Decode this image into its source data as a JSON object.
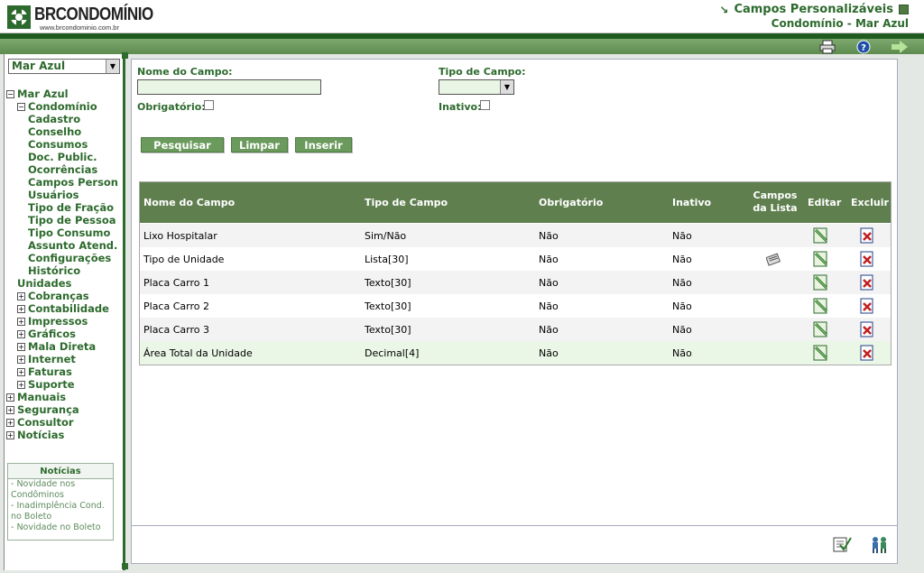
{
  "header": {
    "brand": "BRCONDOMÍNIO",
    "url": "www.brcondominio.com.br",
    "title": "Campos Personalizáveis",
    "subtitle": "Condomínio - Mar Azul"
  },
  "sidebar": {
    "condo_select": "Mar Azul",
    "tree": [
      {
        "label": "Mar Azul",
        "level": 0,
        "toggle": "−"
      },
      {
        "label": "Condomínio",
        "level": 1,
        "toggle": "−"
      },
      {
        "label": "Cadastro",
        "level": 2,
        "toggle": ""
      },
      {
        "label": "Conselho",
        "level": 2,
        "toggle": ""
      },
      {
        "label": "Consumos",
        "level": 2,
        "toggle": ""
      },
      {
        "label": "Doc. Public.",
        "level": 2,
        "toggle": ""
      },
      {
        "label": "Ocorrências",
        "level": 2,
        "toggle": ""
      },
      {
        "label": "Campos Person",
        "level": 2,
        "toggle": ""
      },
      {
        "label": "Usuários",
        "level": 2,
        "toggle": ""
      },
      {
        "label": "Tipo de Fração",
        "level": 2,
        "toggle": ""
      },
      {
        "label": "Tipo de Pessoa",
        "level": 2,
        "toggle": ""
      },
      {
        "label": "Tipo Consumo",
        "level": 2,
        "toggle": ""
      },
      {
        "label": "Assunto Atend.",
        "level": 2,
        "toggle": ""
      },
      {
        "label": "Configurações",
        "level": 2,
        "toggle": ""
      },
      {
        "label": "Histórico",
        "level": 2,
        "toggle": ""
      },
      {
        "label": "Unidades",
        "level": 1,
        "toggle": ""
      },
      {
        "label": "Cobranças",
        "level": 1,
        "toggle": "+"
      },
      {
        "label": "Contabilidade",
        "level": 1,
        "toggle": "+"
      },
      {
        "label": "Impressos",
        "level": 1,
        "toggle": "+"
      },
      {
        "label": "Gráficos",
        "level": 1,
        "toggle": "+"
      },
      {
        "label": "Mala Direta",
        "level": 1,
        "toggle": "+"
      },
      {
        "label": "Internet",
        "level": 1,
        "toggle": "+"
      },
      {
        "label": "Faturas",
        "level": 1,
        "toggle": "+"
      },
      {
        "label": "Suporte",
        "level": 1,
        "toggle": "+"
      },
      {
        "label": "Manuais",
        "level": 0,
        "toggle": "+"
      },
      {
        "label": "Segurança",
        "level": 0,
        "toggle": "+"
      },
      {
        "label": "Consultor",
        "level": 0,
        "toggle": "+"
      },
      {
        "label": "Notícias",
        "level": 0,
        "toggle": "+"
      }
    ],
    "news": {
      "heading": "Notícias",
      "items": [
        "- Novidade nos",
        "Condôminos",
        "- Inadimplência Cond.",
        "no Boleto",
        "- Novidade no Boleto"
      ]
    }
  },
  "form": {
    "field_name_label": "Nome do Campo:",
    "field_name_value": "",
    "field_type_label": "Tipo de Campo:",
    "field_type_value": "",
    "required_label": "Obrigatório:",
    "inactive_label": "Inativo:",
    "buttons": {
      "search": "Pesquisar",
      "clear": "Limpar",
      "insert": "Inserir"
    }
  },
  "table": {
    "columns": {
      "name": "Nome do Campo",
      "type": "Tipo de Campo",
      "required": "Obrigatório",
      "inactive": "Inativo",
      "list_fields_1": "Campos",
      "list_fields_2": "da Lista",
      "edit": "Editar",
      "delete": "Excluir"
    },
    "rows": [
      {
        "name": "Lixo Hospitalar",
        "type": "Sim/Não",
        "required": "Não",
        "inactive": "Não",
        "has_list": false
      },
      {
        "name": "Tipo de Unidade",
        "type": "Lista[30]",
        "required": "Não",
        "inactive": "Não",
        "has_list": true
      },
      {
        "name": "Placa Carro 1",
        "type": "Texto[30]",
        "required": "Não",
        "inactive": "Não",
        "has_list": false
      },
      {
        "name": "Placa Carro 2",
        "type": "Texto[30]",
        "required": "Não",
        "inactive": "Não",
        "has_list": false
      },
      {
        "name": "Placa Carro 3",
        "type": "Texto[30]",
        "required": "Não",
        "inactive": "Não",
        "has_list": false
      },
      {
        "name": "Área Total da Unidade",
        "type": "Decimal[4]",
        "required": "Não",
        "inactive": "Não",
        "has_list": false
      }
    ]
  },
  "icons": {
    "toolbar": [
      "printer-icon",
      "help-icon",
      "exit-icon"
    ],
    "bottom": [
      "checklist-icon",
      "users-icon"
    ]
  },
  "colors": {
    "brand_green": "#2d6a2d",
    "table_header": "#5f7f4f",
    "button": "#6a9a5c",
    "input_bg": "#eaf6e5",
    "row_alt": "#f3f3f3",
    "row_highlight": "#eaf6e6"
  }
}
